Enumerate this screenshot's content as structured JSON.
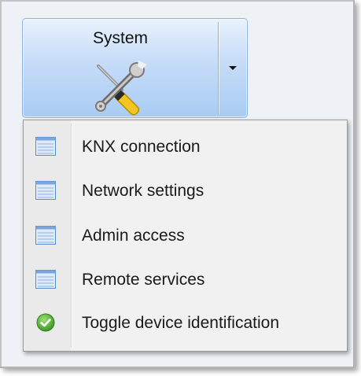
{
  "system_button": {
    "label": "System",
    "icon": "tools-icon",
    "dropdown_icon": "chevron-down-icon"
  },
  "menu": {
    "items": [
      {
        "label": "KNX connection",
        "icon": "list-icon"
      },
      {
        "label": "Network settings",
        "icon": "list-icon"
      },
      {
        "label": "Admin access",
        "icon": "list-icon"
      },
      {
        "label": "Remote services",
        "icon": "list-icon"
      },
      {
        "label": "Toggle device identification",
        "icon": "check-circle-icon"
      }
    ]
  },
  "colors": {
    "button_gradient_top": "#e9f2fd",
    "button_gradient_bottom": "#a9cbf3",
    "list_icon_blue": "#5b8fd0",
    "check_green": "#4caf2e"
  }
}
